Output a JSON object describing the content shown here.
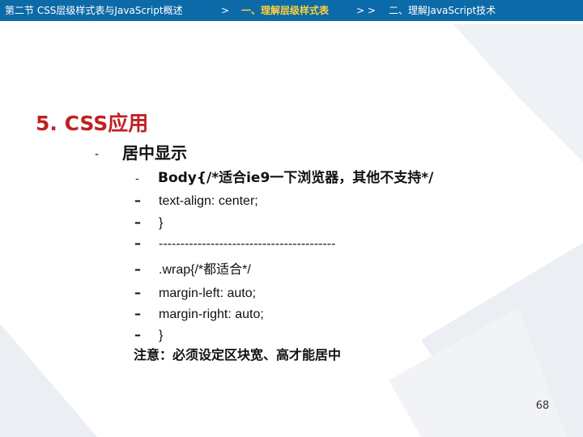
{
  "breadcrumb": {
    "part1": "第二节 CSS层级样式表与JavaScript概述",
    "sep1": ">",
    "part2": "一、理解层级样式表",
    "sep2": "> >",
    "part3": "二、理解JavaScript技术"
  },
  "slide": {
    "title": "5. CSS应用",
    "bullet_marker": "-",
    "heading": "居中显示",
    "sub_marker": "-",
    "sub_heading": "Body{/*适合ie9一下浏览器，其他不支持*/",
    "dash": "–",
    "code_lines": [
      "text-align: center;",
      "}",
      "-----------------------------------------",
      ".wrap{/*都适合*/",
      "margin-left: auto;",
      "margin-right: auto;",
      "}"
    ],
    "note": "注意：必须设定区块宽、高才能居中",
    "page_number": "68"
  }
}
